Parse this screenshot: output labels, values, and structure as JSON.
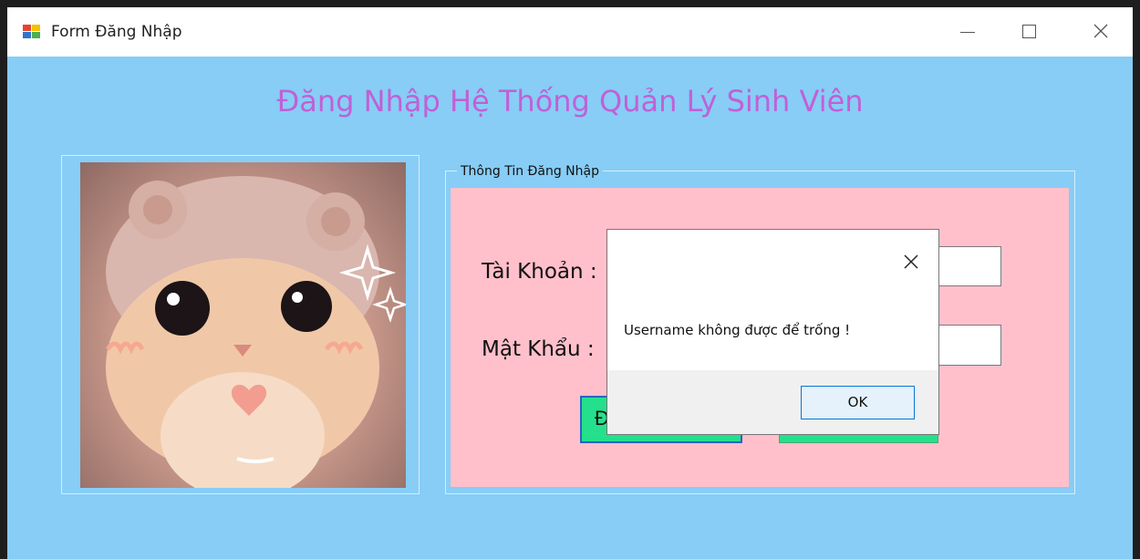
{
  "window": {
    "title": "Form Đăng Nhập",
    "icon": "windows-form-icon",
    "controls": [
      "minimize-icon",
      "maximize-icon",
      "close-icon"
    ]
  },
  "form": {
    "heading": "Đăng Nhập Hệ Thống Quản Lý Sinh Viên",
    "heading_color": "#c160d6",
    "background_color": "#87cdf6",
    "picture": "cute-cat-photo",
    "group_title": "Thông Tin Đăng Nhập",
    "group_background_color": "#ffc0cb",
    "username_label": "Tài Khoản :",
    "password_label": "Mật Khẩu :",
    "username_value": "",
    "password_value": "",
    "login_button_label": "Đ",
    "exit_button_label": "",
    "button_color": "#24e08d"
  },
  "dialog": {
    "message": "Username không được để trống !",
    "ok_label": "OK",
    "close_icon": "close-icon"
  }
}
